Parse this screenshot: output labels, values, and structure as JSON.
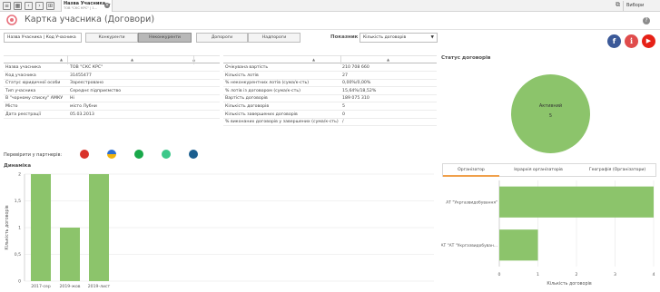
{
  "topbar": {
    "app_tab_title": "Назва Учасника...",
    "app_tab_subtitle": "ТОВ \"СКС КРС\" | 1...",
    "selection_label": "Вибори"
  },
  "header": {
    "title": "Картка учасника (Договори)",
    "help": "?"
  },
  "filters": {
    "search_label": "Назва Учасника | Код Учасника",
    "tabs": [
      {
        "label": "Конкуренти",
        "active": false
      },
      {
        "label": "Неконкуренти",
        "active": true
      },
      {
        "label": "Допороги",
        "active": false
      },
      {
        "label": "Надпороги",
        "active": false
      }
    ],
    "measure_label": "Показник",
    "measure_value": "Кількість договорів",
    "dropdown_arrow": "▼"
  },
  "social": [
    {
      "icon": "facebook-icon",
      "glyph": "f",
      "color": "#3b5998"
    },
    {
      "icon": "info-icon",
      "glyph": "i",
      "color": "#e04c4c"
    },
    {
      "icon": "youtube-icon",
      "glyph": "▶",
      "color": "#e62117"
    }
  ],
  "info_table": {
    "rows": [
      {
        "label": "Назва учасника",
        "value": "ТОВ \"СКС КРС\""
      },
      {
        "label": "Код учасника",
        "value": "31455477"
      },
      {
        "label": "Статус юридичної особи",
        "value": "Зареєстровано"
      },
      {
        "label": "Тип учасника",
        "value": "Середнє підприємство"
      },
      {
        "label": "В \"чорному списку\" АМКУ",
        "value": "Ні"
      },
      {
        "label": "Місто",
        "value": "місто Лубни"
      },
      {
        "label": "Дата реєстрації",
        "value": "05.03.2013"
      }
    ]
  },
  "metrics_table": {
    "rows": [
      {
        "label": "Очікувана вартість",
        "value": "210 708 660"
      },
      {
        "label": "Кількість лотів",
        "value": "27"
      },
      {
        "label": "% неконкурентних лотів (сума/к-сть)",
        "value": "0,00%/0,00%"
      },
      {
        "label": "% лотів із договором (сума/к-сть)",
        "value": "15,64%/18,52%"
      },
      {
        "label": "Вартість договорів",
        "value": "189 075 310"
      },
      {
        "label": "Кількість договорів",
        "value": "5"
      },
      {
        "label": "Кількість завершених договорів",
        "value": "0"
      },
      {
        "label": "% виконаних договорів у завершених (сума/к-сть)",
        "value": "/"
      }
    ]
  },
  "status": {
    "title": "Статус договорів",
    "slice_label": "Активний",
    "slice_value": "5",
    "color": "#8cc46b"
  },
  "partners": {
    "label": "Перевірити у партнерів:",
    "logos": [
      {
        "icon": "partner-red-icon",
        "color": "#d9332b"
      },
      {
        "icon": "partner-yellow-blue-icon",
        "color": "#f2b40c"
      },
      {
        "icon": "partner-green-icon",
        "color": "#19a84a"
      },
      {
        "icon": "partner-light-green-icon",
        "color": "#3cc88a"
      },
      {
        "icon": "partner-blue-icon",
        "color": "#1b5f8f"
      }
    ]
  },
  "dynamics": {
    "title": "Динаміка"
  },
  "right_panel": {
    "tabs": [
      {
        "label": "Організатор",
        "active": true
      },
      {
        "label": "Ієрархія організаторів",
        "active": false
      },
      {
        "label": "Географія (Організатори)",
        "active": false
      }
    ]
  },
  "chart_data": [
    {
      "type": "bar",
      "title": "Динаміка",
      "categories": [
        "2017-сер",
        "2019-жов",
        "2019-лист"
      ],
      "values": [
        2,
        1,
        2
      ],
      "xlabel": "",
      "ylabel": "Кількість договорів",
      "ylim": [
        0,
        2
      ],
      "yticks": [
        0,
        0.5,
        1,
        1.5,
        2
      ],
      "ytick_labels": [
        "0",
        "0,5",
        "1",
        "1,5",
        "2"
      ],
      "grid": true,
      "color": "#8cc46b"
    },
    {
      "type": "bar",
      "orientation": "horizontal",
      "categories": [
        "АТ \"Укргазвидобування\"",
        "АТ \"АТ \"Укргазвидобуван..."
      ],
      "values": [
        4,
        1
      ],
      "xlabel": "Кількість договорів",
      "ylabel": "",
      "xlim": [
        0,
        4
      ],
      "xticks": [
        0,
        1,
        2,
        3,
        4
      ],
      "grid": true,
      "color": "#8cc46b"
    }
  ]
}
